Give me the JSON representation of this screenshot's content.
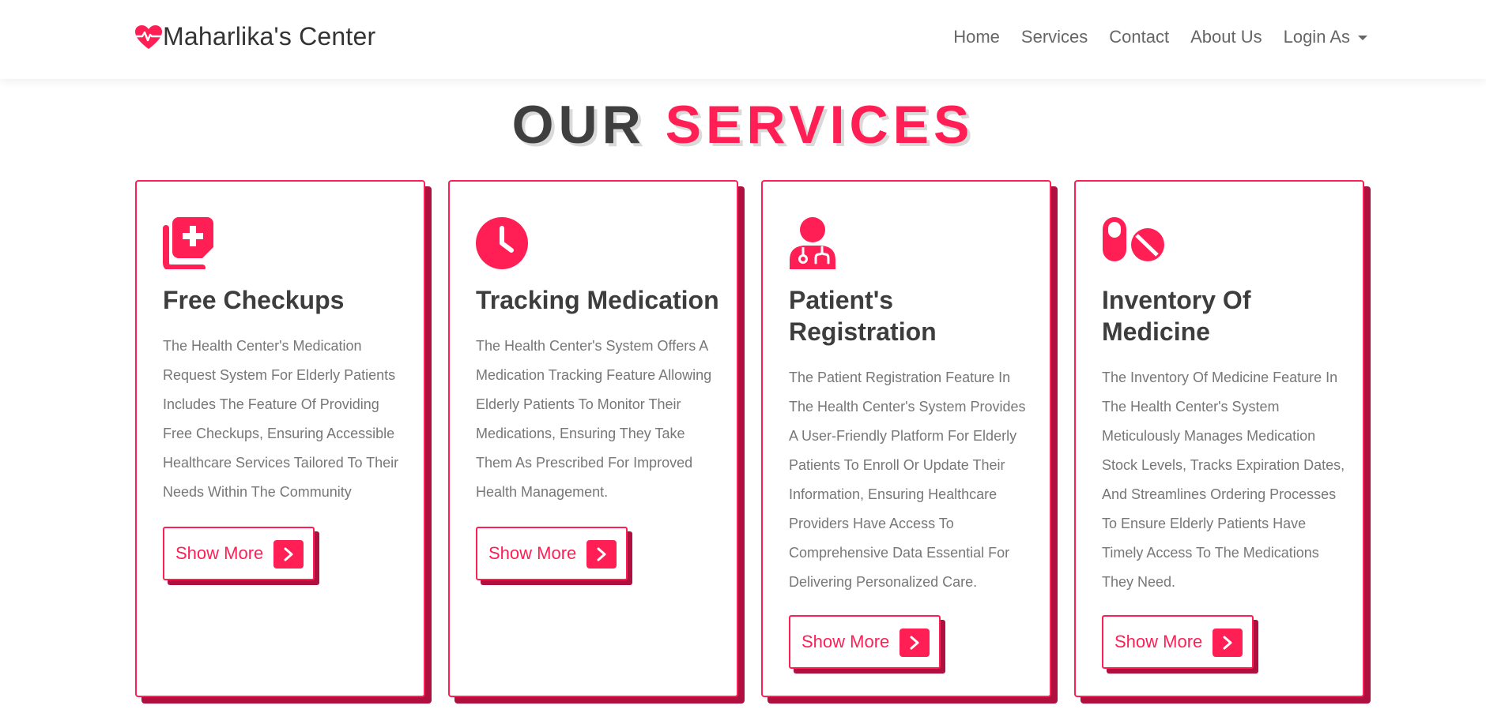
{
  "brand": {
    "name": "Maharlika's Center",
    "icon": "heart-pulse-icon",
    "accent_color": "#ff1f55"
  },
  "nav": {
    "items": [
      {
        "label": "Home"
      },
      {
        "label": "Services"
      },
      {
        "label": "Contact"
      },
      {
        "label": "About Us"
      }
    ],
    "dropdown": {
      "label": "Login As"
    }
  },
  "section": {
    "title_part1": "OUR",
    "title_part2": "SERVICES"
  },
  "cards": [
    {
      "icon": "notes-medical-icon",
      "title": "Free Checkups",
      "description": "The Health Center's Medication Request System For Elderly Patients Includes The Feature Of Providing Free Checkups, Ensuring Accessible Healthcare Services Tailored To Their Needs Within The Community",
      "button_label": "Show More"
    },
    {
      "icon": "clock-icon",
      "title": "Tracking Medication",
      "description": "The Health Center's System Offers A Medication Tracking Feature Allowing Elderly Patients To Monitor Their Medications, Ensuring They Take Them As Prescribed For Improved Health Management.",
      "button_label": "Show More"
    },
    {
      "icon": "user-doctor-icon",
      "title": "Patient's Registration",
      "description": "The Patient Registration Feature In The Health Center's System Provides A User-Friendly Platform For Elderly Patients To Enroll Or Update Their Information, Ensuring Healthcare Providers Have Access To Comprehensive Data Essential For Delivering Personalized Care.",
      "button_label": "Show More"
    },
    {
      "icon": "pills-icon",
      "title": "Inventory Of Medicine",
      "description": "The Inventory Of Medicine Feature In The Health Center's System Meticulously Manages Medication Stock Levels, Tracks Expiration Dates, And Streamlines Ordering Processes To Ensure Elderly Patients Have Timely Access To The Medications They Need.",
      "button_label": "Show More"
    }
  ]
}
